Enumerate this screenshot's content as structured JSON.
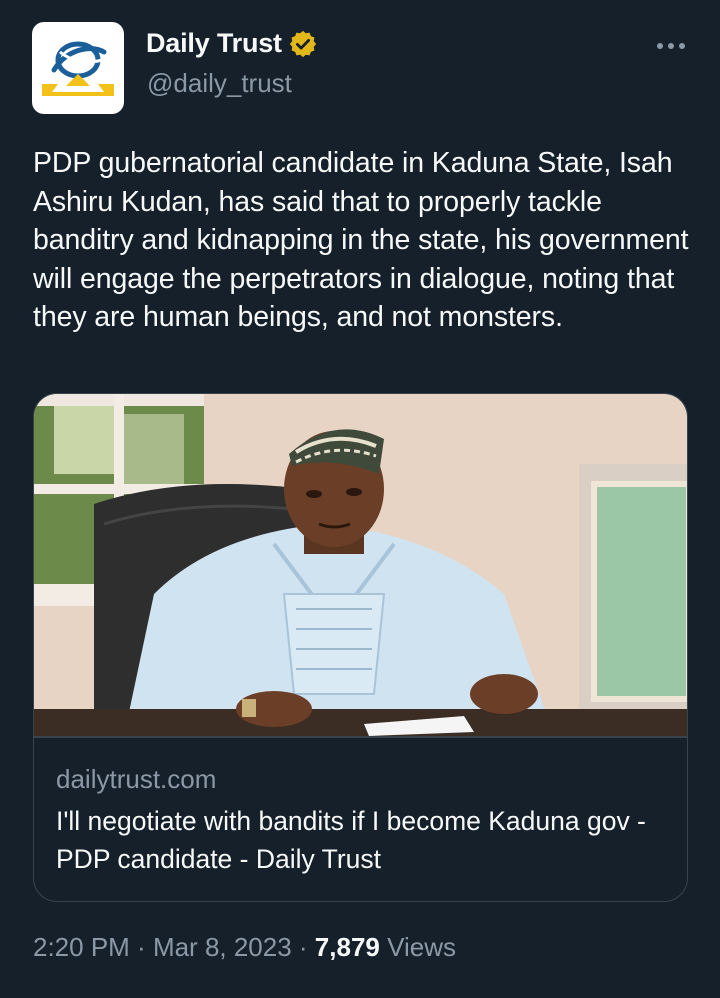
{
  "author": {
    "display_name": "Daily Trust",
    "handle": "@daily_trust",
    "verified_color": "#e2b719",
    "avatar_icon": "daily-trust-logo"
  },
  "more_icon": "more-horizontal-icon",
  "tweet": {
    "text": "PDP gubernatorial candidate in Kaduna State, Isah Ashiru Kudan, has said that to properly tackle banditry and kidnapping in the state, his government will engage the perpetrators in dialogue, noting that they are human beings, and not monsters."
  },
  "card": {
    "domain": "dailytrust.com",
    "title": "I'll negotiate with bandits if I become Kaduna gov - PDP candidate - Daily Trust"
  },
  "meta": {
    "time": "2:20 PM",
    "separator": " · ",
    "date": "Mar 8, 2023",
    "views_count": "7,879",
    "views_label": " Views"
  },
  "colors": {
    "background": "#15202b",
    "text_primary": "#f7f9f9",
    "text_secondary": "#8b98a5",
    "border": "#38444d"
  }
}
